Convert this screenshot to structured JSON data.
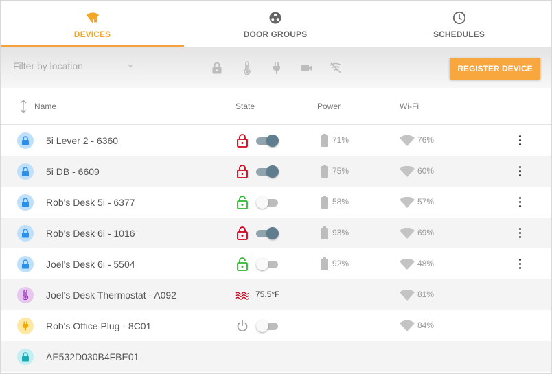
{
  "tabs": [
    {
      "label": "DEVICES",
      "icon": "wifi-lock-icon",
      "active": true
    },
    {
      "label": "DOOR GROUPS",
      "icon": "group-icon",
      "active": false
    },
    {
      "label": "SCHEDULES",
      "icon": "clock-icon",
      "active": false
    }
  ],
  "toolbar": {
    "filter_placeholder": "Filter by location",
    "filter_icons": [
      "lock-icon",
      "thermometer-icon",
      "plug-icon",
      "camera-icon",
      "wifi-off-icon"
    ],
    "register_label": "REGISTER DEVICE"
  },
  "columns": {
    "name": "Name",
    "state": "State",
    "power": "Power",
    "wifi": "Wi-Fi"
  },
  "devices": [
    {
      "name": "5i Lever 2 - 6360",
      "type": "lock",
      "state": "locked",
      "power": "71%",
      "wifi": "76%"
    },
    {
      "name": "5i DB - 6609",
      "type": "lock",
      "state": "locked",
      "power": "75%",
      "wifi": "60%"
    },
    {
      "name": "Rob's Desk 5i - 6377",
      "type": "lock",
      "state": "unlocked",
      "power": "58%",
      "wifi": "57%"
    },
    {
      "name": "Rob's Desk 6i - 1016",
      "type": "lock",
      "state": "locked",
      "power": "93%",
      "wifi": "69%"
    },
    {
      "name": "Joel's Desk 6i - 5504",
      "type": "lock",
      "state": "unlocked",
      "power": "92%",
      "wifi": "48%"
    },
    {
      "name": "Joel's Desk Thermostat - A092",
      "type": "thermostat",
      "temperature": "75.5°F",
      "wifi": "81%"
    },
    {
      "name": "Rob's Office Plug - 8C01",
      "type": "plug",
      "state": "off",
      "wifi": "84%"
    },
    {
      "name": "AE532D030B4FBE01",
      "type": "lock-unregistered"
    }
  ],
  "colors": {
    "accent": "#f5a623",
    "locked": "#d0021b",
    "unlocked": "#2eb82e",
    "lock_avatar": "#bfe0fb",
    "lock_avatar_icon": "#2f8ee5",
    "thermo_avatar": "#e6c7ef",
    "thermo_avatar_icon": "#9b3bbf",
    "plug_avatar": "#fde8a6",
    "plug_avatar_icon": "#f2a900",
    "unreg_avatar": "#c3eef2",
    "unreg_avatar_icon": "#1aaab5"
  }
}
